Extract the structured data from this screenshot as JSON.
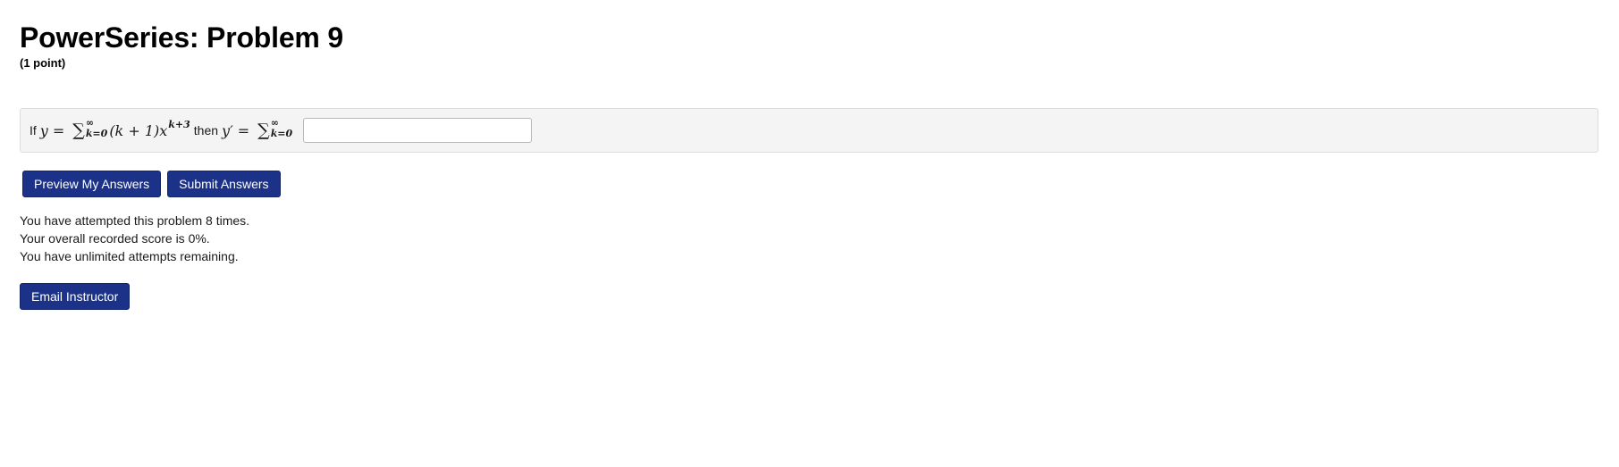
{
  "problem": {
    "title": "PowerSeries: Problem 9",
    "points": "(1 point)"
  },
  "statement": {
    "prefix": "If",
    "lhs_var": "y",
    "eq": "=",
    "sigma": "∑",
    "sum_upper": "∞",
    "sum_lower": "k=0",
    "term": "(k + 1)x",
    "term_exponent": "k+3",
    "connector": "then",
    "rhs_var": "y′",
    "answer_value": "",
    "answer_placeholder": ""
  },
  "buttons": {
    "preview": "Preview My Answers",
    "submit": "Submit Answers",
    "email": "Email Instructor"
  },
  "status": {
    "attempts": "You have attempted this problem 8 times.",
    "score": "Your overall recorded score is 0%.",
    "remaining": "You have unlimited attempts remaining."
  },
  "colors": {
    "button_bg": "#1b3288",
    "problem_bg": "#f4f4f4"
  }
}
